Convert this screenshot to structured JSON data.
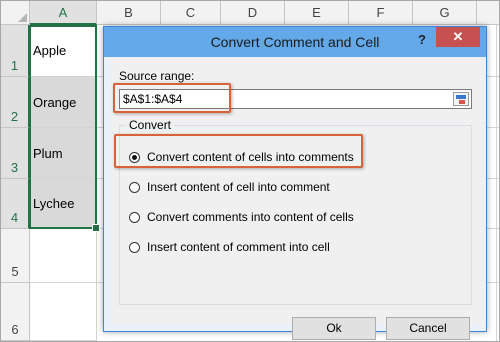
{
  "sheet": {
    "columns": [
      "A",
      "B",
      "C",
      "D",
      "E",
      "F",
      "G"
    ],
    "rows": [
      "1",
      "2",
      "3",
      "4",
      "5",
      "6"
    ],
    "cells": [
      "Apple",
      "Orange",
      "Plum",
      "Lychee"
    ]
  },
  "dialog": {
    "title": "Convert Comment and Cell",
    "help": "?",
    "close": "✕",
    "source_label": "Source range:",
    "source_value": "$A$1:$A$4",
    "group_label": "Convert",
    "options": [
      "Convert content of cells into comments",
      "Insert content of cell into comment",
      "Convert comments into content of cells",
      "Insert content of comment into cell"
    ],
    "selected_option": 0,
    "ok": "Ok",
    "cancel": "Cancel"
  },
  "colors": {
    "accent": "#217346",
    "title_bar": "#63a8e8",
    "highlight": "#d9623b",
    "close": "#c75050"
  }
}
